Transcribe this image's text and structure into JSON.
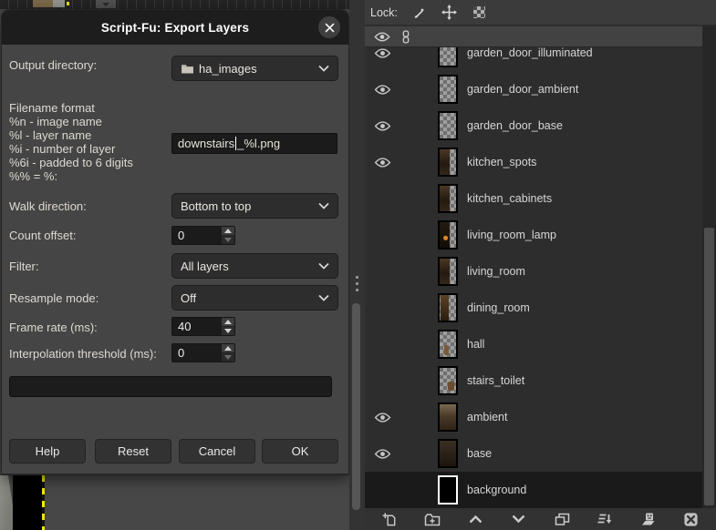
{
  "dialog": {
    "title": "Script-Fu: Export Layers",
    "fields": {
      "output_directory": {
        "label": "Output directory:",
        "value": "ha_images"
      },
      "filename_format": {
        "lines": [
          "Filename format",
          "%n - image name",
          "%l - layer name",
          "%i - number of layer",
          "%6i - padded to 6 digits",
          "%% = %:"
        ],
        "value_before_cursor": "downstairs",
        "value_after_cursor": "_%l.png"
      },
      "walk_direction": {
        "label": "Walk direction:",
        "value": "Bottom to top"
      },
      "count_offset": {
        "label": "Count offset:",
        "value": "0"
      },
      "filter": {
        "label": "Filter:",
        "value": "All layers"
      },
      "resample_mode": {
        "label": "Resample mode:",
        "value": "Off"
      },
      "frame_rate": {
        "label": "Frame rate (ms):",
        "value": "40"
      },
      "interpolation_threshold": {
        "label": "Interpolation threshold (ms):",
        "value": "0"
      }
    },
    "buttons": {
      "help": "Help",
      "reset": "Reset",
      "cancel": "Cancel",
      "ok": "OK"
    },
    "icons": [
      "close-icon",
      "folder-icon",
      "chevron-down-icon"
    ]
  },
  "layers_panel": {
    "lock_label": "Lock:",
    "lock_icons": [
      "paintbrush-icon",
      "move-icon",
      "alpha-checker-icon"
    ],
    "header_icons": [
      "visibility-eye-icon",
      "chain-link-icon"
    ],
    "rows": [
      {
        "name": "garden_door_illuminated",
        "visible": true,
        "thumb": "checker",
        "selected": false,
        "clipped": true
      },
      {
        "name": "garden_door_ambient",
        "visible": true,
        "thumb": "checker",
        "selected": false
      },
      {
        "name": "garden_door_base",
        "visible": true,
        "thumb": "checker",
        "selected": false
      },
      {
        "name": "kitchen_spots",
        "visible": true,
        "thumb": "photo-left",
        "selected": false
      },
      {
        "name": "kitchen_cabinets",
        "visible": false,
        "thumb": "photo-left",
        "selected": false
      },
      {
        "name": "living_room_lamp",
        "visible": false,
        "thumb": "photo-left-lamp",
        "selected": false
      },
      {
        "name": "living_room",
        "visible": false,
        "thumb": "photo-left",
        "selected": false
      },
      {
        "name": "dining_room",
        "visible": false,
        "thumb": "photo-narrow",
        "selected": false
      },
      {
        "name": "hall",
        "visible": false,
        "thumb": "blob-left",
        "selected": false
      },
      {
        "name": "stairs_toilet",
        "visible": false,
        "thumb": "blob-right",
        "selected": false
      },
      {
        "name": "ambient",
        "visible": true,
        "thumb": "photo-full-light",
        "selected": false
      },
      {
        "name": "base",
        "visible": true,
        "thumb": "photo-full-dark",
        "selected": false
      },
      {
        "name": "background",
        "visible": false,
        "thumb": "solid-black",
        "selected": true
      }
    ],
    "toolbar_icons": [
      "new-layer-icon",
      "new-layer-group-icon",
      "raise-layer-icon",
      "lower-layer-icon",
      "duplicate-layer-icon",
      "merge-down-icon",
      "add-layer-mask-icon",
      "delete-layer-icon"
    ]
  },
  "colors": {
    "dialog_bg": "#454545",
    "titlebar_bg": "#1d1d1d",
    "input_bg": "#1b1b1b",
    "dropdown_bg": "#2d2d2d",
    "list_bg": "#2d2d2d",
    "selected_row_bg": "#1a1a1a",
    "selection_dash_yellow": "#f2e400",
    "icon_gray": "#c9c9c9"
  }
}
